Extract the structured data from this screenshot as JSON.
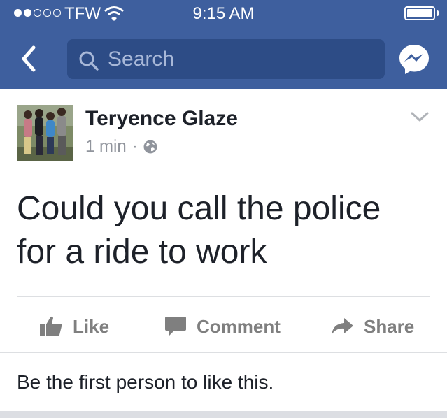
{
  "status_bar": {
    "carrier": "TFW",
    "time": "9:15 AM",
    "signal_icon": "signal-dots-icon",
    "wifi_icon": "wifi-icon",
    "battery_icon": "battery-icon"
  },
  "nav": {
    "back_icon": "back-chevron-icon",
    "search_placeholder": "Search",
    "messenger_icon": "messenger-icon"
  },
  "post": {
    "author": "Teryence Glaze",
    "time": "1 min",
    "separator": "·",
    "privacy_icon": "globe-icon",
    "text_line1": "Could you call the police",
    "text_line2": "for a ride to work"
  },
  "actions": {
    "like": "Like",
    "comment": "Comment",
    "share": "Share"
  },
  "likes_summary": "Be the first person to like this.",
  "colors": {
    "brand_blue": "#3e5f9e",
    "search_bg": "#2d4c86",
    "action_gray": "#7f7f7f",
    "meta_gray": "#90949c"
  }
}
